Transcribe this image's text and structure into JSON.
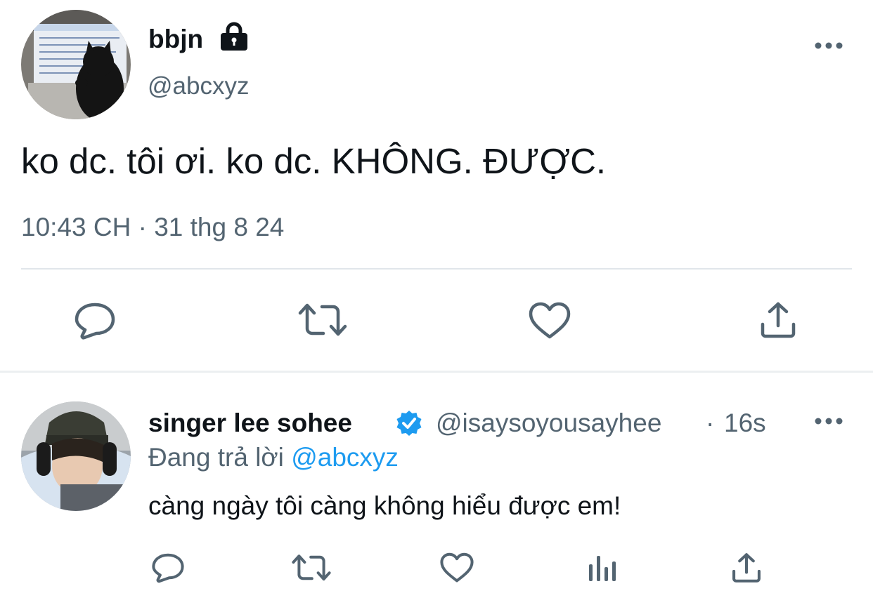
{
  "main_tweet": {
    "display_name": "bbjn",
    "handle": "@abcxyz",
    "text": "ko dc. tôi ơi. ko dc. KHÔNG. ĐƯỢC.",
    "timestamp": "10:43 CH · 31 thg 8 24",
    "protected_icon": "lock-icon",
    "more_icon": "more-horizontal-icon",
    "actions": [
      "reply-icon",
      "retweet-icon",
      "like-icon",
      "share-icon"
    ]
  },
  "reply_tweet": {
    "display_name": "singer lee sohee",
    "verified_icon": "verified-badge-icon",
    "handle": "@isaysoyousayhee",
    "separator": "·",
    "time": "16s",
    "replying_to_label": "Đang trả lời",
    "replying_to_handle": "@abcxyz",
    "text": "càng ngày tôi càng không hiểu được em!",
    "more_icon": "more-horizontal-icon",
    "actions": [
      "reply-icon",
      "retweet-icon",
      "like-icon",
      "analytics-icon",
      "share-icon"
    ]
  },
  "colors": {
    "text_primary": "#0f1419",
    "text_secondary": "#536471",
    "accent": "#1d9bf0",
    "divider": "#e1e6ea"
  }
}
